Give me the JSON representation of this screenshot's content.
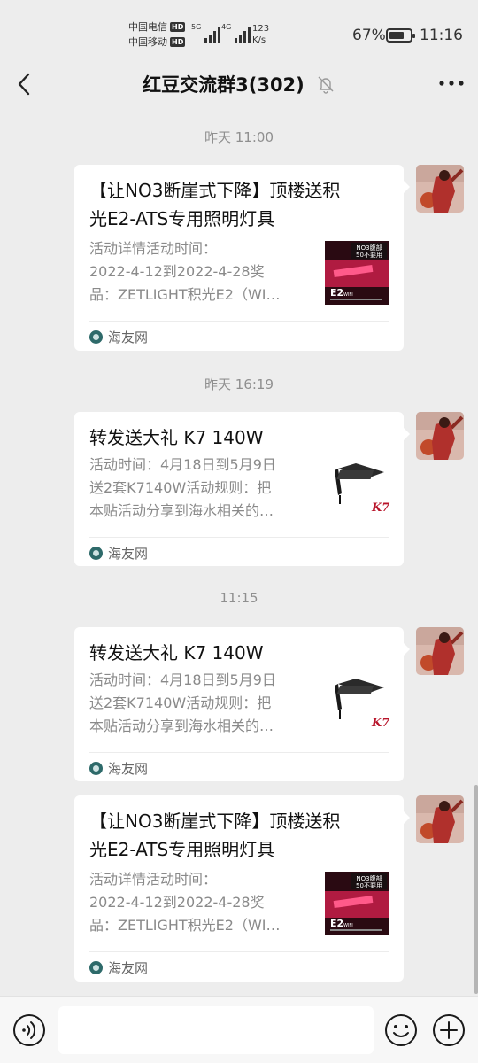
{
  "status": {
    "carrier1": "中国电信",
    "carrier2": "中国移动",
    "hd": "HD",
    "sig1_label": "5G",
    "sig2_label": "4G",
    "speed_value": "123",
    "speed_unit": "K/s",
    "battery": "67%",
    "battery_level": 0.67,
    "time": "11:16"
  },
  "header": {
    "title": "红豆交流群3(302)",
    "back_icon": "chevron-left-icon",
    "mute_icon": "bell-off-icon",
    "more_icon": "more-dots-icon"
  },
  "messages": [
    {
      "time": "昨天 11:00",
      "title_line1": "【让NO3断崖式下降】顶楼送积",
      "title_line2": "光E2-ATS专用照明灯具",
      "desc": [
        "活动详情活动时间：",
        "2022-4-12到2022-4-28奖",
        "品：ZETLIGHT积光E2（WI…"
      ],
      "source": "海友网",
      "thumb_label1": "NO3腹部",
      "thumb_label2": "50不要用",
      "thumb_label3": "E2",
      "thumb_label4": "WIFI"
    },
    {
      "time": "昨天 16:19",
      "title_line1": "转发送大礼 K7 140W",
      "desc": [
        "活动时间：4月18日到5月9日",
        "送2套K7140W活动规则：把",
        "本贴活动分享到海水相关的…"
      ],
      "source": "海友网",
      "thumb_label1": "K7"
    },
    {
      "time": "11:15",
      "title_line1": "转发送大礼 K7 140W",
      "desc": [
        "活动时间：4月18日到5月9日",
        "送2套K7140W活动规则：把",
        "本贴活动分享到海水相关的…"
      ],
      "source": "海友网",
      "thumb_label1": "K7"
    },
    {
      "title_line1": "【让NO3断崖式下降】顶楼送积",
      "title_line2": "光E2-ATS专用照明灯具",
      "desc": [
        "活动详情活动时间：",
        "2022-4-12到2022-4-28奖",
        "品：ZETLIGHT积光E2（WI…"
      ],
      "source": "海友网",
      "thumb_label1": "NO3腹部",
      "thumb_label2": "50不要用",
      "thumb_label3": "E2",
      "thumb_label4": "WIFI"
    }
  ],
  "input": {
    "voice_icon": "voice-icon",
    "emoji_icon": "emoji-icon",
    "plus_icon": "plus-circle-icon"
  }
}
